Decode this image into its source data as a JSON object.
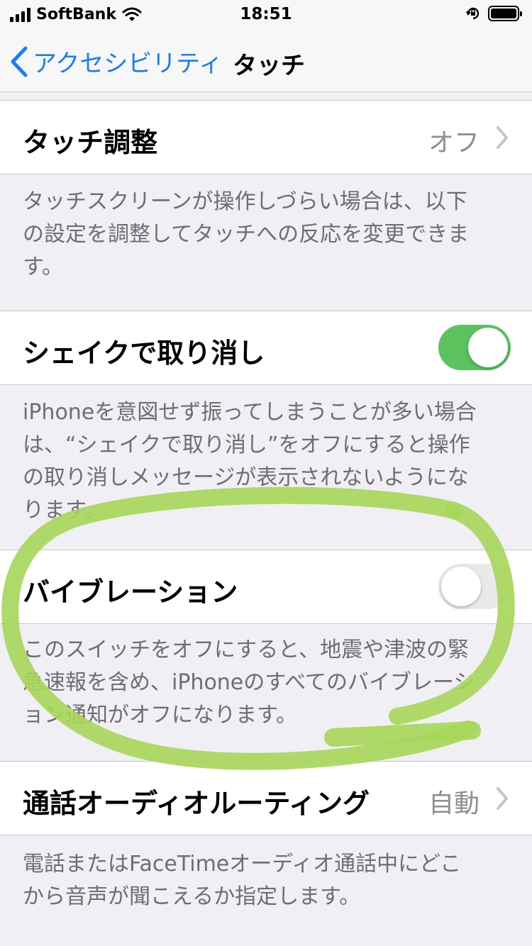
{
  "status_bar": {
    "carrier": "SoftBank",
    "time": "18:51"
  },
  "nav": {
    "back_label": "アクセシビリティ",
    "title": "タッチ"
  },
  "settings": {
    "touch_accommodations": {
      "label": "タッチ調整",
      "value": "オフ"
    },
    "touch_footer_lines": [
      "タッチスクリーンが操作しづらい場合は、以下",
      "の設定を調整してタッチへの反応を変更できま",
      "す。"
    ],
    "shake_to_undo": {
      "label": "シェイクで取り消し",
      "enabled": true
    },
    "shake_footer_lines": [
      "iPhoneを意図せず振ってしまうことが多い場合",
      "は、“シェイクで取り消し”をオフにすると操作",
      "の取り消しメッセージが表示されないようにな",
      "ります。"
    ],
    "vibration": {
      "label": "バイブレーション",
      "enabled": false
    },
    "vibration_footer_lines": [
      "このスイッチをオフにすると、地震や津波の緊",
      "急速報を含め、iPhoneのすべてのバイブレーシ",
      "ョン通知がオフになります。"
    ],
    "call_audio_routing": {
      "label": "通話オーディオルーティング",
      "value": "自動"
    },
    "call_footer_lines": [
      "電話またはFaceTimeオーディオ通話中にどこ",
      "から音声が聞こえるか指定します。"
    ]
  },
  "colors": {
    "tint": "#1e7cf2",
    "switch_on": "#5bc25e",
    "highlight": "#a6d65a"
  },
  "icons": {
    "back": "chevron-left-icon",
    "disclosure": "chevron-right-icon",
    "wifi": "wifi-icon",
    "orientation_lock": "orientation-lock-icon",
    "battery": "battery-icon",
    "signal": "signal-bars-icon"
  }
}
